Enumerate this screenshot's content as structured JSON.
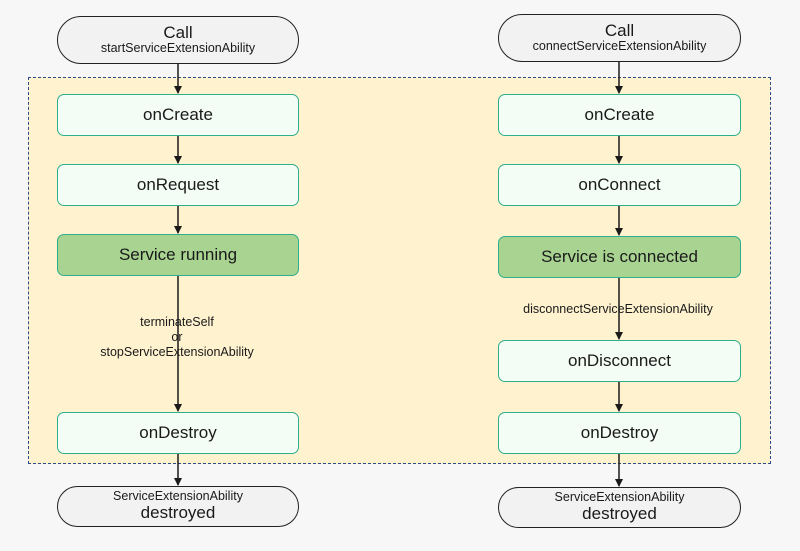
{
  "left_flow": {
    "start": {
      "title": "Call",
      "subtitle": "startServiceExtensionAbility"
    },
    "steps": [
      "onCreate",
      "onRequest",
      "Service running",
      "onDestroy"
    ],
    "transition_label": [
      "terminateSelf",
      "or",
      "stopServiceExtensionAbility"
    ],
    "end": {
      "subtitle": "ServiceExtensionAbility",
      "title": "destroyed"
    }
  },
  "right_flow": {
    "start": {
      "title": "Call",
      "subtitle": "connectServiceExtensionAbility"
    },
    "steps": [
      "onCreate",
      "onConnect",
      "Service is connected",
      "onDisconnect",
      "onDestroy"
    ],
    "transition_label": "disconnectServiceExtensionAbility",
    "end": {
      "subtitle": "ServiceExtensionAbility",
      "title": "destroyed"
    }
  },
  "colors": {
    "region_fill": "#fff2cf",
    "region_border": "#2b4a8a",
    "box_border": "#2fae8c",
    "box_fill": "#f3fcf5",
    "state_fill": "#a8d391",
    "terminal_fill": "#f2f2f2"
  }
}
